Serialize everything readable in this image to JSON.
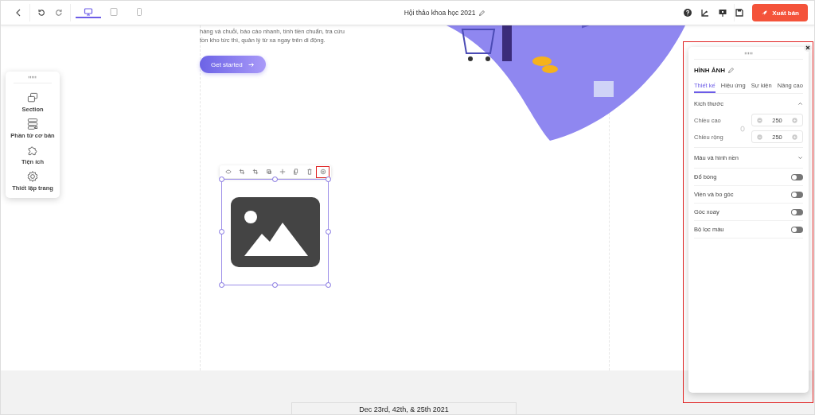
{
  "toolbar": {
    "devices": [
      {
        "kind": "desktop",
        "selected": true
      },
      {
        "kind": "tablet",
        "selected": false
      },
      {
        "kind": "mobile",
        "selected": false
      }
    ],
    "title": "Hội thảo khoa học 2021",
    "publish_button": "Xuất bản"
  },
  "hero": {
    "text_lines": [
      "hàng và chuỗi, báo cáo nhanh, tính tiền chuẩn, tra cứu",
      "tồn kho tức thì, quản lý từ xa ngay trên di động."
    ],
    "button": "Get started"
  },
  "elements_panel": {
    "items": [
      {
        "kind": "section",
        "label": "Section"
      },
      {
        "kind": "basic",
        "label": "Phần tử cơ bản"
      },
      {
        "kind": "widget",
        "label": "Tiện ích"
      },
      {
        "kind": "settings",
        "label": "Thiết lập trang"
      }
    ]
  },
  "image_toolbar": {
    "tools": [
      {
        "kind": "eye",
        "highlighted": false
      },
      {
        "kind": "crop",
        "highlighted": false
      },
      {
        "kind": "crop2",
        "highlighted": false
      },
      {
        "kind": "layers",
        "highlighted": false
      },
      {
        "kind": "move",
        "highlighted": false
      },
      {
        "kind": "copy",
        "highlighted": false
      },
      {
        "kind": "trash",
        "highlighted": false
      },
      {
        "kind": "settings",
        "highlighted": true
      }
    ]
  },
  "properties_panel": {
    "highlighted": true,
    "title": "HÌNH ẢNH",
    "tabs": [
      {
        "label": "Thiết kế",
        "selected": true
      },
      {
        "label": "Hiệu ứng",
        "selected": false
      },
      {
        "label": "Sự kiện",
        "selected": false
      },
      {
        "label": "Nâng cao",
        "selected": false
      }
    ],
    "size_section": {
      "title": "Kích thước",
      "expanded": true,
      "fields": [
        {
          "label": "Chiều cao",
          "value": "250"
        },
        {
          "label": "Chiều rộng",
          "value": "250"
        }
      ]
    },
    "color_section": {
      "title": "Màu và hình nền",
      "expanded": false
    },
    "toggles": [
      {
        "label": "Đổ bóng",
        "on": false
      },
      {
        "label": "Viền và bo góc",
        "on": false
      },
      {
        "label": "Góc xoay",
        "on": false
      },
      {
        "label": "Bộ lọc màu",
        "on": false
      }
    ]
  },
  "footer_text": "Dec 23rd, 42th, & 25th 2021"
}
